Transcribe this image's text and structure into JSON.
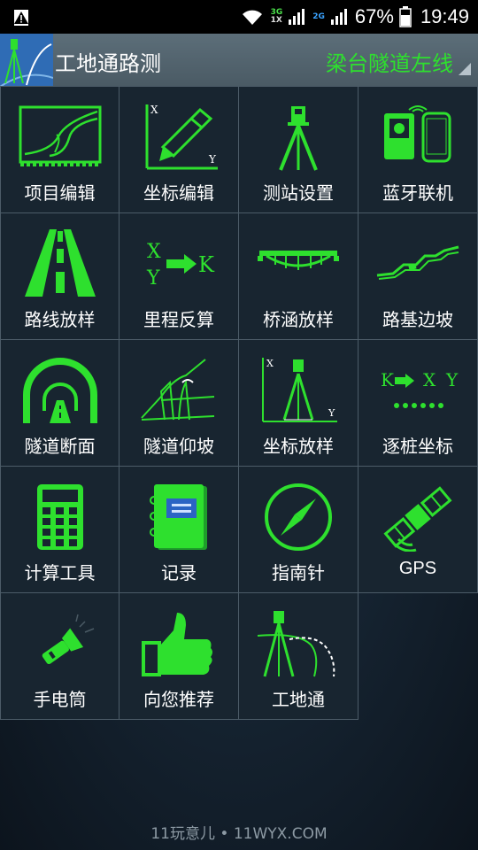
{
  "status_bar": {
    "battery": "67%",
    "time": "19:49",
    "net_top": "3G",
    "net_mid": "1X",
    "net_2g": "2G"
  },
  "header": {
    "title": "工地通路测",
    "project": "梁台隧道左线"
  },
  "tiles": [
    {
      "label": "项目编辑",
      "icon": "road-curve-icon"
    },
    {
      "label": "坐标编辑",
      "icon": "coordinate-edit-icon"
    },
    {
      "label": "测站设置",
      "icon": "total-station-icon"
    },
    {
      "label": "蓝牙联机",
      "icon": "bluetooth-connect-icon"
    },
    {
      "label": "路线放样",
      "icon": "road-icon"
    },
    {
      "label": "里程反算",
      "icon": "xy-to-k-icon"
    },
    {
      "label": "桥涵放样",
      "icon": "bridge-icon"
    },
    {
      "label": "路基边坡",
      "icon": "slope-icon"
    },
    {
      "label": "隧道断面",
      "icon": "tunnel-section-icon"
    },
    {
      "label": "隧道仰坡",
      "icon": "tunnel-slope-icon"
    },
    {
      "label": "坐标放样",
      "icon": "coordinate-stakeout-icon"
    },
    {
      "label": "逐桩坐标",
      "icon": "k-to-xy-icon"
    },
    {
      "label": "计算工具",
      "icon": "calculator-icon"
    },
    {
      "label": "记录",
      "icon": "notebook-icon"
    },
    {
      "label": "指南针",
      "icon": "compass-icon"
    },
    {
      "label": "GPS",
      "icon": "satellite-icon"
    },
    {
      "label": "手电筒",
      "icon": "flashlight-icon"
    },
    {
      "label": "向您推荐",
      "icon": "thumbs-up-icon"
    },
    {
      "label": "工地通",
      "icon": "survey-road-icon"
    }
  ],
  "icon_labels": {
    "x": "X",
    "y": "Y",
    "k": "K"
  },
  "footer": {
    "watermark": "11玩意儿 • 11WYX.COM"
  },
  "colors": {
    "accent": "#2ee02e",
    "tile_bg": "#182530",
    "tile_border": "#4c5c68",
    "header_bg": "#55666f"
  }
}
